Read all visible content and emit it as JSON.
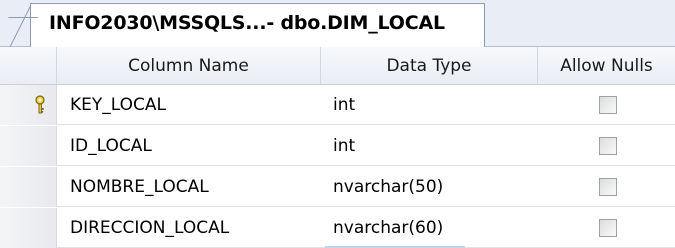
{
  "tab": {
    "title": "INFO2030\\MSSQLS...- dbo.DIM_LOCAL"
  },
  "columns": {
    "selector": "",
    "name": "Column Name",
    "type": "Data Type",
    "nulls": "Allow Nulls"
  },
  "rows": [
    {
      "name": "KEY_LOCAL",
      "type": "int",
      "allow_nulls": false,
      "primary_key": true
    },
    {
      "name": "ID_LOCAL",
      "type": "int",
      "allow_nulls": false,
      "primary_key": false
    },
    {
      "name": "NOMBRE_LOCAL",
      "type": "nvarchar(50)",
      "allow_nulls": false,
      "primary_key": false
    },
    {
      "name": "DIRECCION_LOCAL",
      "type": "nvarchar(60)",
      "allow_nulls": false,
      "primary_key": false
    }
  ],
  "icons": {
    "primary_key": "key-icon"
  },
  "colors": {
    "tab_background": "#e8edf6",
    "key_icon": "#e8c23a",
    "checkbox_border": "#9aa2ad"
  }
}
